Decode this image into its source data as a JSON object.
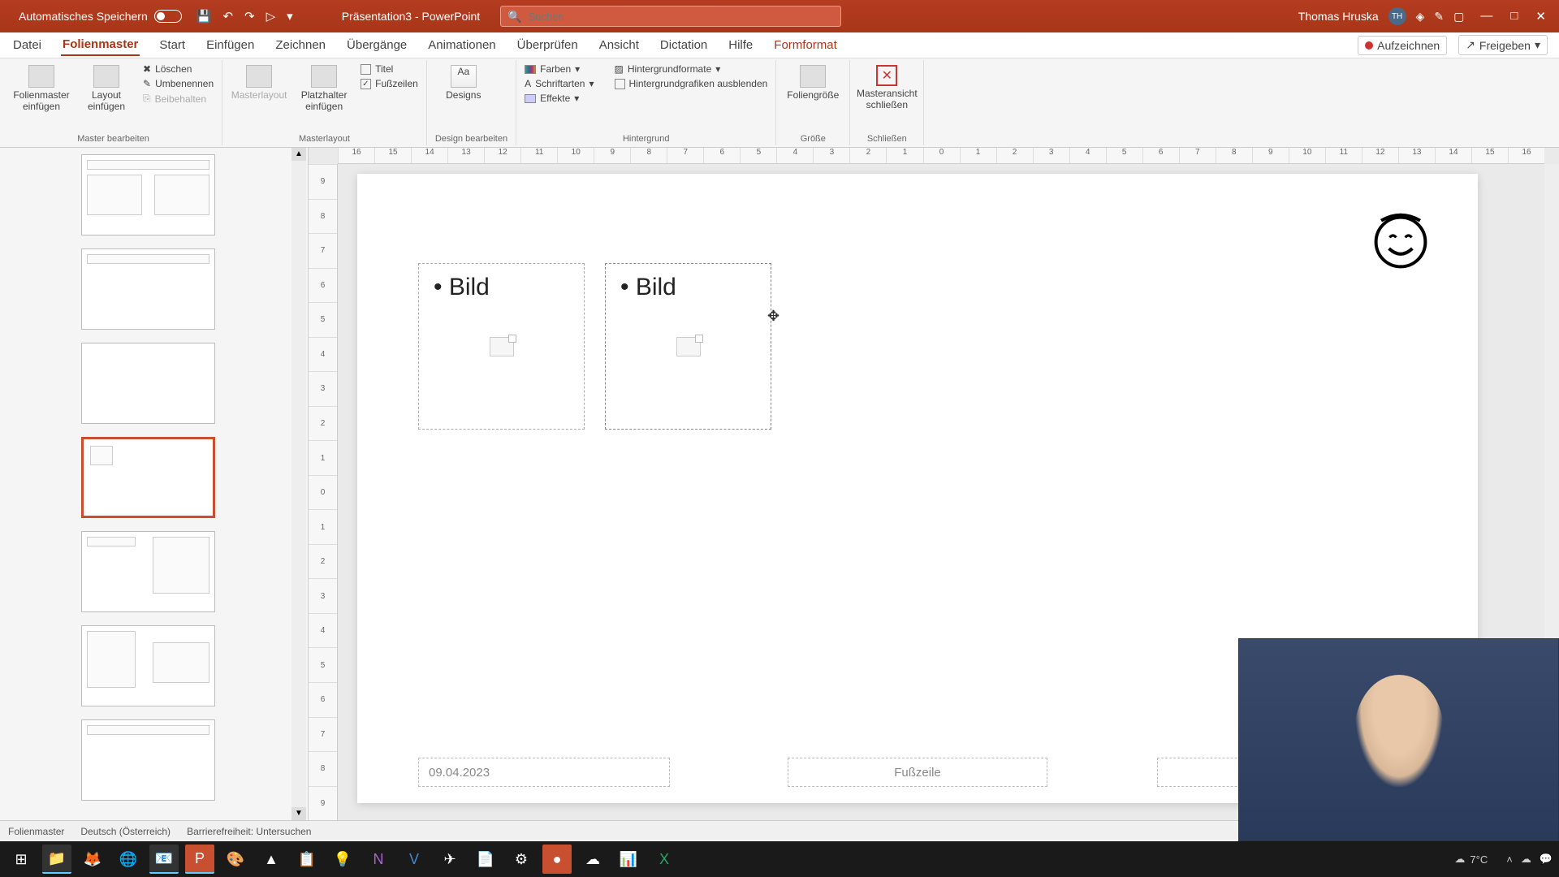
{
  "titlebar": {
    "autosave_label": "Automatisches Speichern",
    "doc_title": "Präsentation3 - PowerPoint",
    "search_placeholder": "Suchen",
    "user_name": "Thomas Hruska",
    "user_initials": "TH"
  },
  "menu": {
    "tabs": [
      "Datei",
      "Folienmaster",
      "Start",
      "Einfügen",
      "Zeichnen",
      "Übergänge",
      "Animationen",
      "Überprüfen",
      "Ansicht",
      "Dictation",
      "Hilfe"
    ],
    "context_tab": "Formformat",
    "active_index": 1,
    "record": "Aufzeichnen",
    "share": "Freigeben"
  },
  "ribbon": {
    "group1": {
      "btn1": "Folienmaster einfügen",
      "btn2": "Layout einfügen",
      "s1": "Löschen",
      "s2": "Umbenennen",
      "s3": "Beibehalten",
      "label": "Master bearbeiten"
    },
    "group2": {
      "btn1": "Masterlayout",
      "btn2": "Platzhalter einfügen",
      "cb1": "Titel",
      "cb2": "Fußzeilen",
      "label": "Masterlayout"
    },
    "group3": {
      "btn1": "Designs",
      "label": "Design bearbeiten"
    },
    "group4": {
      "s1": "Farben",
      "s2": "Schriftarten",
      "s3": "Effekte",
      "s4": "Hintergrundformate",
      "cb1": "Hintergrundgrafiken ausblenden",
      "label": "Hintergrund"
    },
    "group5": {
      "btn1": "Foliengröße",
      "label": "Größe"
    },
    "group6": {
      "btn1": "Masteransicht schließen",
      "label": "Schließen"
    }
  },
  "ruler_h": [
    "16",
    "15",
    "14",
    "13",
    "12",
    "11",
    "10",
    "9",
    "8",
    "7",
    "6",
    "5",
    "4",
    "3",
    "2",
    "1",
    "0",
    "1",
    "2",
    "3",
    "4",
    "5",
    "6",
    "7",
    "8",
    "9",
    "10",
    "11",
    "12",
    "13",
    "14",
    "15",
    "16"
  ],
  "ruler_v": [
    "9",
    "8",
    "7",
    "6",
    "5",
    "4",
    "3",
    "2",
    "1",
    "0",
    "1",
    "2",
    "3",
    "4",
    "5",
    "6",
    "7",
    "8",
    "9"
  ],
  "slide": {
    "ph1_text": "Bild",
    "ph2_text": "Bild",
    "date": "09.04.2023",
    "footer": "Fußzeile"
  },
  "status": {
    "view": "Folienmaster",
    "lang": "Deutsch (Österreich)",
    "access": "Barrierefreiheit: Untersuchen"
  },
  "taskbar": {
    "temp": "7°C"
  }
}
